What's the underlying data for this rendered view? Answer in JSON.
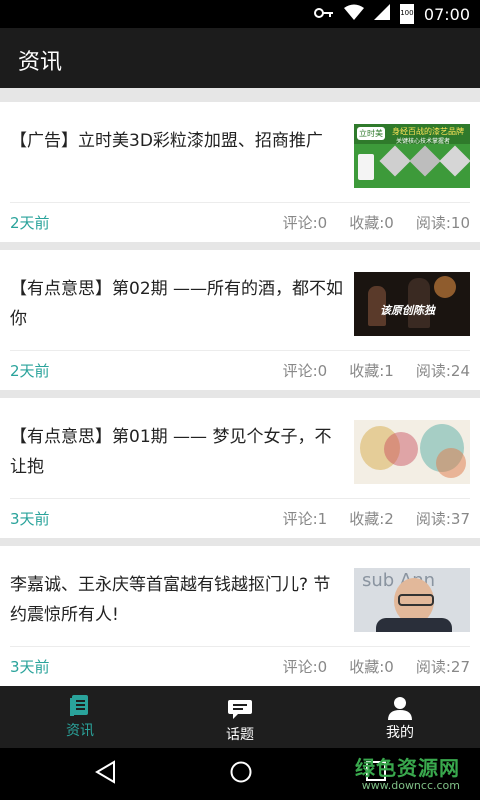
{
  "status_bar": {
    "battery": "100",
    "time": "07:00"
  },
  "app_bar": {
    "title": "资讯"
  },
  "articles": [
    {
      "title": "【广告】立时美3D彩粒漆加盟、招商推广",
      "time": "2天前",
      "comments": "评论:0",
      "favorites": "收藏:0",
      "reads": "阅读:10",
      "thumb_brand": "立时美",
      "thumb_slogan": "身经百战的漆艺品牌",
      "thumb_sub": "关键核心技术掌握者"
    },
    {
      "title": "【有点意思】第02期 ——所有的酒，都不如你",
      "time": "2天前",
      "comments": "评论:0",
      "favorites": "收藏:1",
      "reads": "阅读:24",
      "thumb_text": "该原创陈独"
    },
    {
      "title": "【有点意思】第01期 —— 梦见个女子，不让抱",
      "time": "3天前",
      "comments": "评论:1",
      "favorites": "收藏:2",
      "reads": "阅读:37"
    },
    {
      "title": "李嘉诚、王永庆等首富越有钱越抠门儿? 节约震惊所有人!",
      "time": "3天前",
      "comments": "评论:0",
      "favorites": "收藏:0",
      "reads": "阅读:27",
      "thumb_text": "sub Ann"
    }
  ],
  "bottom_nav": [
    {
      "label": "资讯",
      "icon": "news-icon"
    },
    {
      "label": "话题",
      "icon": "chat-icon"
    },
    {
      "label": "我的",
      "icon": "user-icon"
    }
  ],
  "watermark": {
    "line1": "绿色资源网",
    "line2": "www.downcc.com"
  },
  "colors": {
    "accent": "#2aa39b",
    "appbar": "#1c1c1c",
    "nav": "#1e1e1e"
  }
}
